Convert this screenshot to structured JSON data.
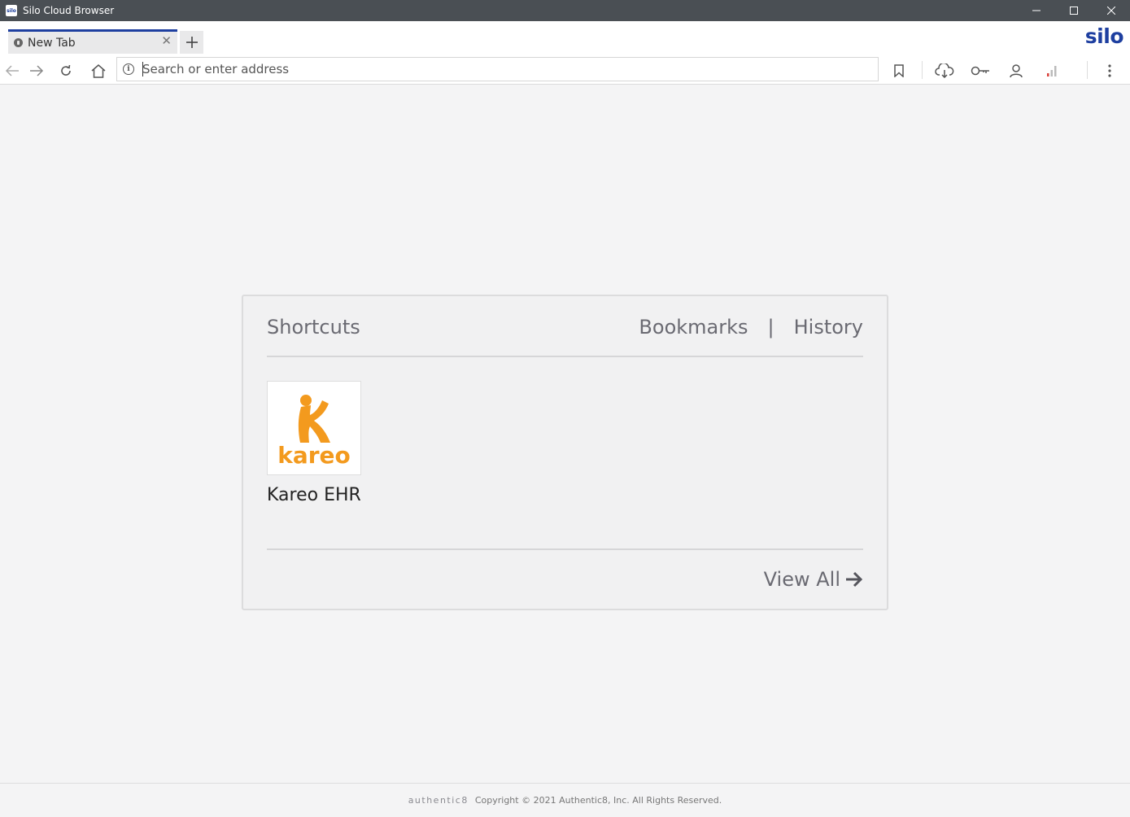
{
  "window": {
    "title": "Silo Cloud Browser",
    "app_icon_text": "silo"
  },
  "tabs": [
    {
      "title": "New Tab"
    }
  ],
  "brand": {
    "logo": "silo",
    "color": "#1e3fa0"
  },
  "address_bar": {
    "placeholder": "Search or enter address",
    "value": ""
  },
  "toolbar": {
    "icons": [
      "back-icon",
      "forward-icon",
      "reload-icon",
      "home-icon",
      "info-icon",
      "bookmark-icon",
      "cloud-download-icon",
      "key-icon",
      "user-icon",
      "signal-icon",
      "menu-icon"
    ]
  },
  "new_tab_page": {
    "shortcuts_heading": "Shortcuts",
    "bookmarks_link": "Bookmarks",
    "separator": "|",
    "history_link": "History",
    "shortcuts": [
      {
        "label": "Kareo EHR",
        "logo_text": "kareo",
        "logo_color": "#f39a1e"
      }
    ],
    "view_all": "View All"
  },
  "footer": {
    "brand": "authentic8",
    "copyright": "Copyright © 2021 Authentic8, Inc. All Rights Reserved."
  }
}
